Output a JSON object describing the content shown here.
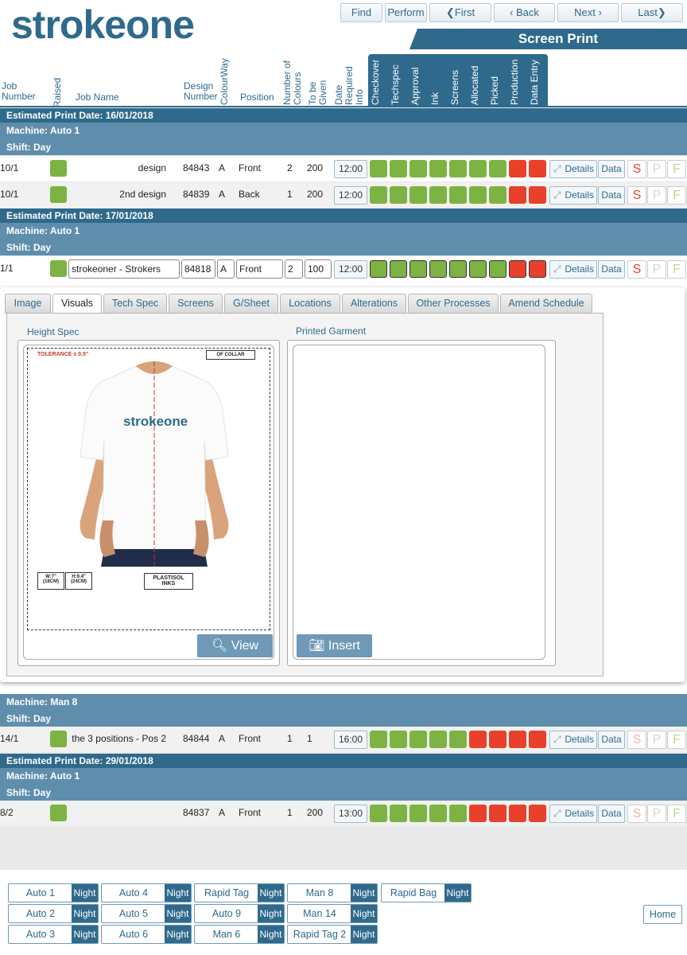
{
  "app": {
    "logo": "strokeone",
    "screen_title": "Screen Print"
  },
  "nav": {
    "find": "Find",
    "perform": "Perform",
    "first": "First",
    "back": "Back",
    "next": "Next",
    "last": "Last"
  },
  "columns": {
    "job_number": "Job Number",
    "raised": "Raised",
    "job_name": "Job Name",
    "design_number": "Design Number",
    "colourway": "ColourWay",
    "position": "Position",
    "number_of_colours": "Number of Colours",
    "to_be_given": "To be Given",
    "date_required_info": "Date Required Info",
    "checkover": "Checkover",
    "techspec": "Techspec",
    "approval": "Approval",
    "ink": "Ink",
    "screens": "Screens",
    "allocated": "Allocated",
    "picked": "Picked",
    "production": "Production",
    "data_entry": "Data Entry"
  },
  "groups": {
    "g1": {
      "est": "Estimated Print Date: 16/01/2018",
      "machine": "Machine: Auto 1",
      "shift": "Shift: Day"
    },
    "g2": {
      "est": "Estimated Print Date: 17/01/2018",
      "machine": "Machine: Auto 1",
      "shift": "Shift: Day"
    },
    "g3": {
      "machine": "Machine: Man 8",
      "shift": "Shift: Day"
    },
    "g4": {
      "est": "Estimated Print Date: 29/01/2018",
      "machine": "Machine: Auto 1",
      "shift": "Shift: Day"
    }
  },
  "rows": [
    {
      "job": "10/1",
      "name": "design",
      "design": "84843",
      "cw": "A",
      "pos": "Front",
      "cols": "2",
      "given": "200",
      "time": "12:00",
      "status": [
        "g",
        "g",
        "g",
        "g",
        "g",
        "g",
        "g",
        "r",
        "r"
      ]
    },
    {
      "job": "10/1",
      "name": "2nd design",
      "design": "84839",
      "cw": "A",
      "pos": "Back",
      "cols": "1",
      "given": "200",
      "time": "12:00",
      "status": [
        "g",
        "g",
        "g",
        "g",
        "g",
        "g",
        "g",
        "r",
        "r"
      ]
    },
    {
      "job": "1/1",
      "name": "strokeoner - Strokers",
      "design": "84818",
      "cw": "A",
      "pos": "Front",
      "cols": "2",
      "given": "100",
      "time": "12:00",
      "status": [
        "g",
        "g",
        "g",
        "g",
        "g",
        "g",
        "g",
        "r",
        "r"
      ]
    },
    {
      "job": "14/1",
      "name": "the 3 positions - Pos 2",
      "design": "84844",
      "cw": "A",
      "pos": "Front",
      "cols": "1",
      "given": "1",
      "time": "16:00",
      "status": [
        "g",
        "g",
        "g",
        "g",
        "g",
        "r",
        "r",
        "r",
        "r"
      ]
    },
    {
      "job": "8/2",
      "name": "",
      "design": "84837",
      "cw": "A",
      "pos": "Front",
      "cols": "1",
      "given": "200",
      "time": "13:00",
      "status": [
        "g",
        "g",
        "g",
        "g",
        "g",
        "r",
        "r",
        "r",
        "r"
      ]
    }
  ],
  "row_buttons": {
    "details": "Details",
    "data": "Data",
    "s": "S",
    "p": "P",
    "f": "F"
  },
  "modal": {
    "tabs": [
      "Image",
      "Visuals",
      "Tech Spec",
      "Screens",
      "G/Sheet",
      "Locations",
      "Alterations",
      "Other Processes",
      "Amend Schedule"
    ],
    "active_tab": "Visuals",
    "height_spec_label": "Height Spec",
    "printed_garment_label": "Printed Garment",
    "tolerance": "TOLERANCE ± 0.5\"",
    "collar_tag": "OF COLLAR",
    "shirt_logo": "strokeone",
    "width_label": "W:7\" (18CM)",
    "height_label": "H:9.4\" (24CM)",
    "ink_label": "PLASTISOL INKS",
    "view_button": "View",
    "insert_button": "Insert"
  },
  "machines": [
    {
      "name": "Auto 1",
      "night": "Night"
    },
    {
      "name": "Auto 4",
      "night": "Night"
    },
    {
      "name": "Rapid Tag",
      "night": "Night"
    },
    {
      "name": "Man 8",
      "night": "Night"
    },
    {
      "name": "Rapid Bag",
      "night": "Night"
    },
    {
      "name": "Auto 2",
      "night": "Night"
    },
    {
      "name": "Auto 5",
      "night": "Night"
    },
    {
      "name": "Auto 9",
      "night": "Night"
    },
    {
      "name": "Man 14",
      "night": "Night"
    },
    {
      "name": "Auto 3",
      "night": "Night"
    },
    {
      "name": "Auto 6",
      "night": "Night"
    },
    {
      "name": "Man 6",
      "night": "Night"
    },
    {
      "name": "Rapid Tag 2",
      "night": "Night"
    }
  ],
  "home": "Home",
  "colors": {
    "primary": "#2f6a8c",
    "band_light": "#5f8ead",
    "green": "#7cb342",
    "red": "#e8402a"
  }
}
